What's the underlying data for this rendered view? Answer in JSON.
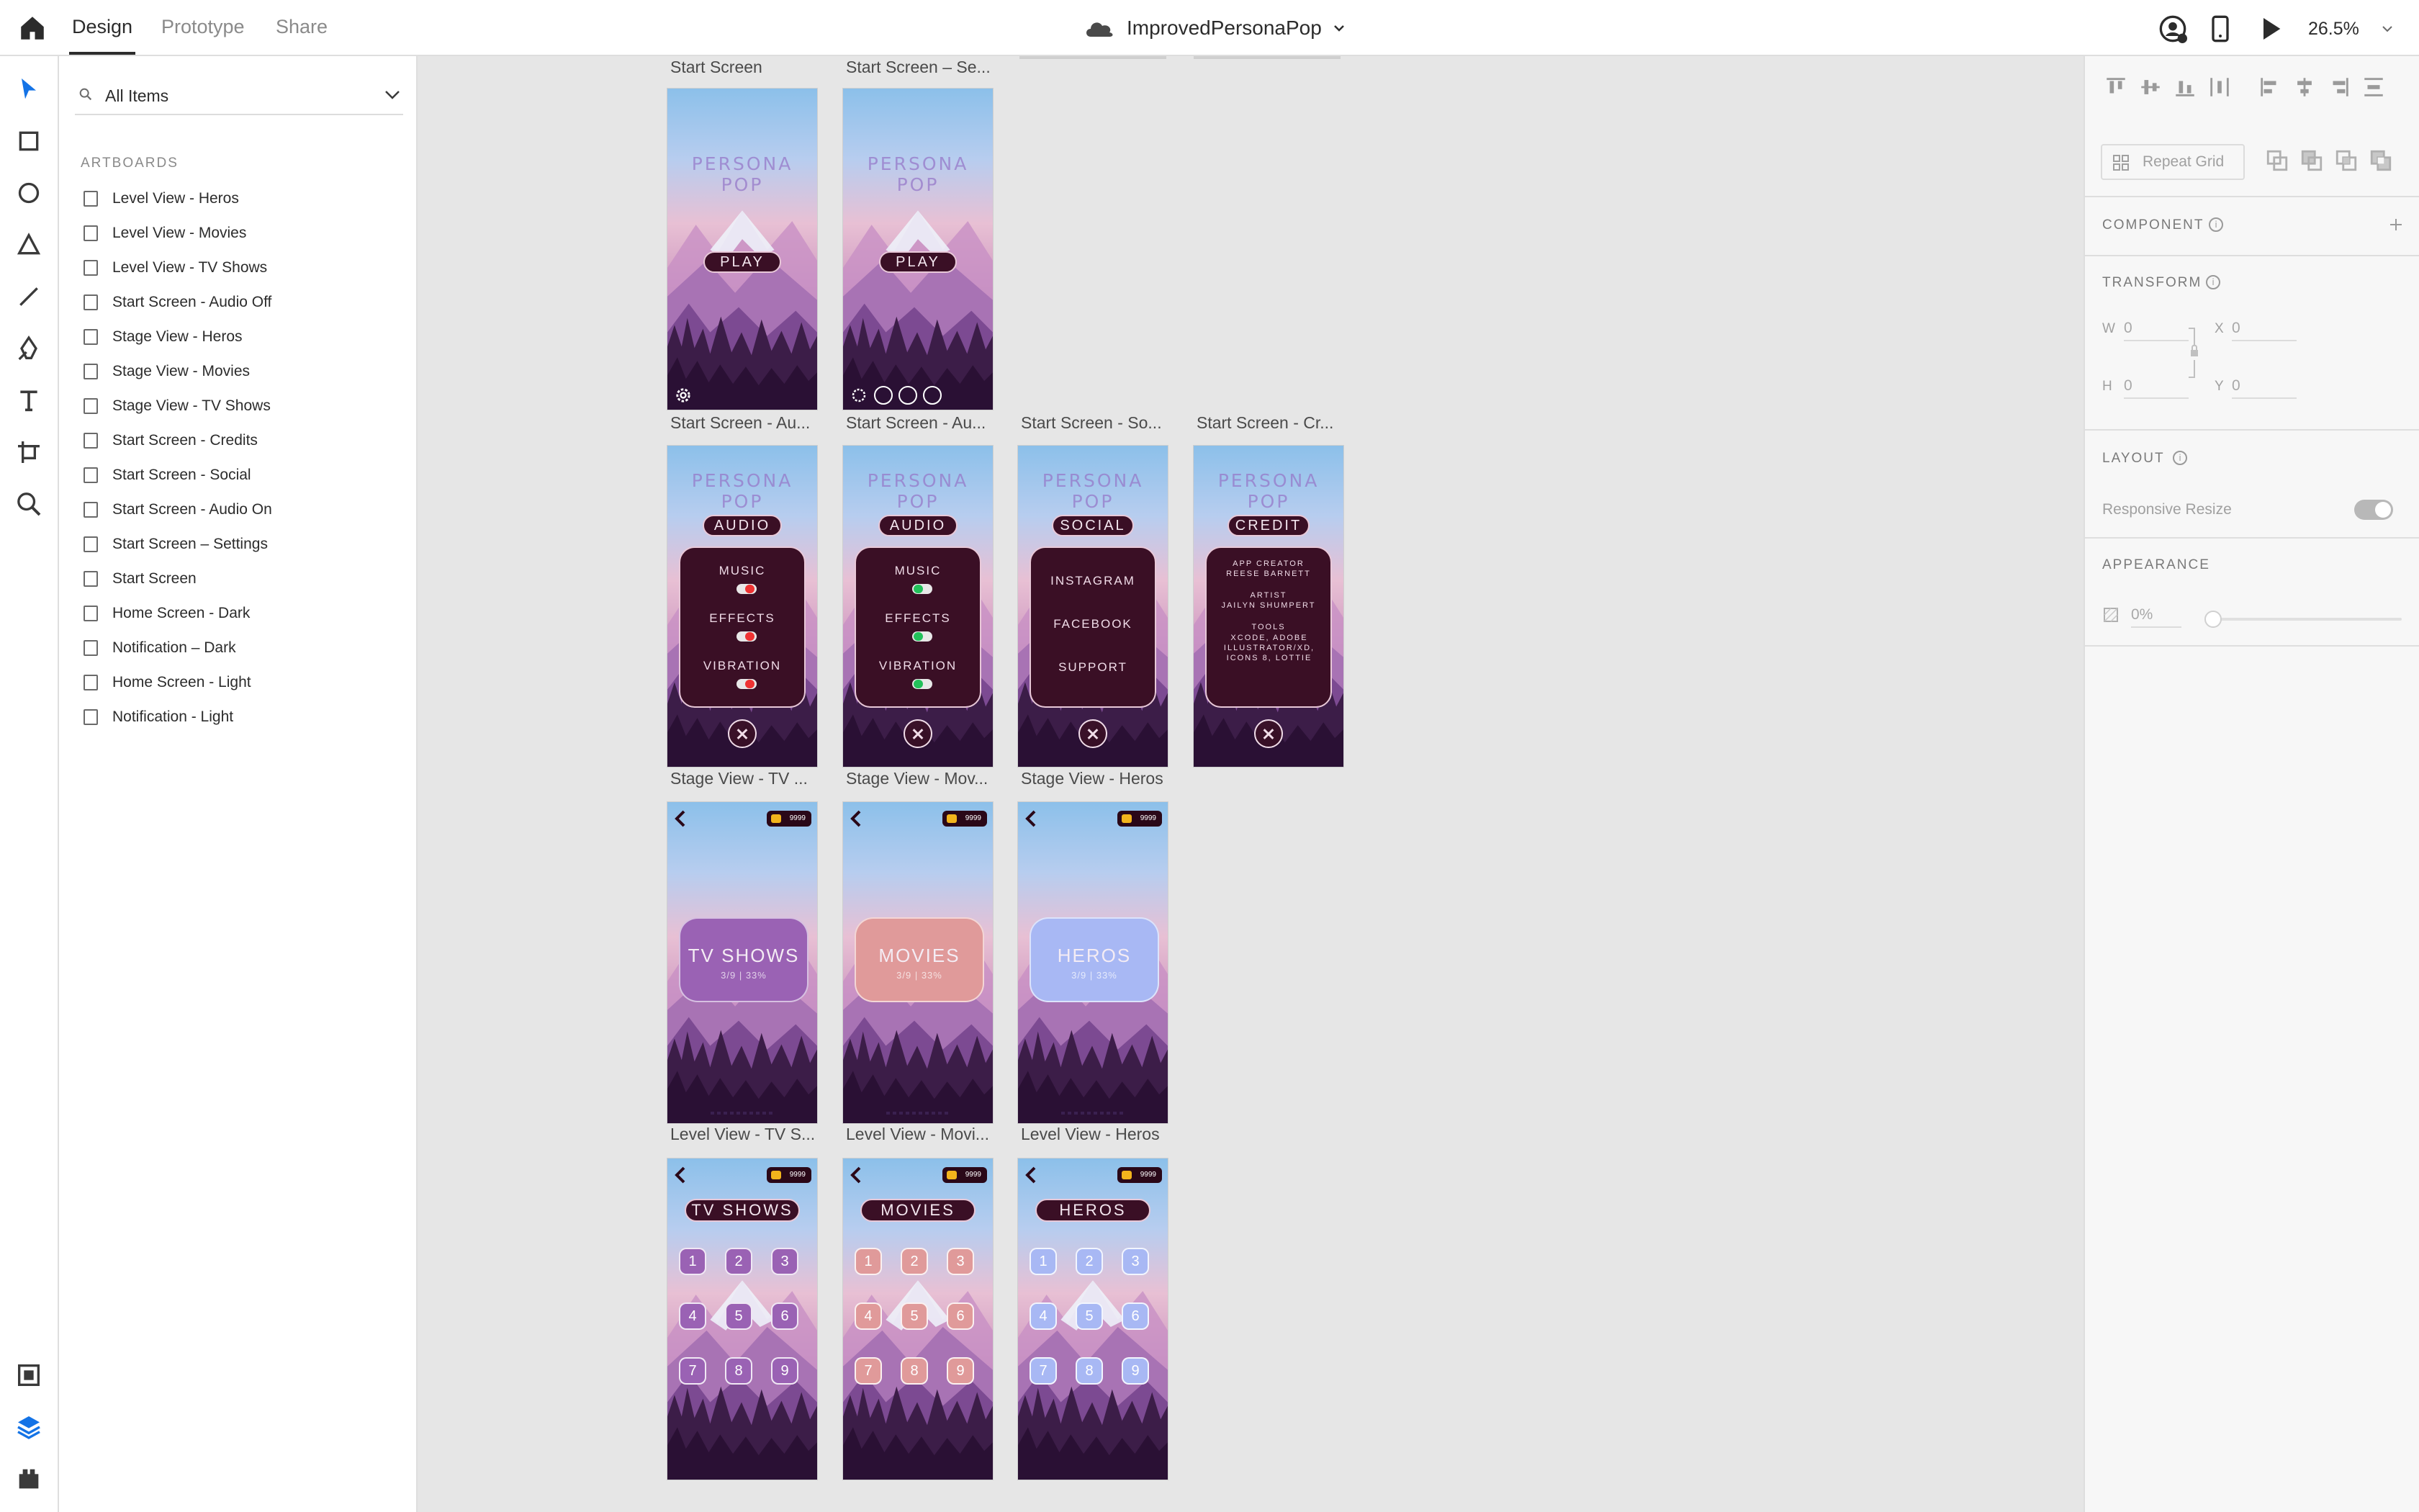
{
  "app": {
    "tabs": [
      {
        "label": "Design",
        "active": true
      },
      {
        "label": "Prototype"
      },
      {
        "label": "Share"
      }
    ],
    "document_title": "ImprovedPersonaPop",
    "zoom": "26.5%"
  },
  "layers": {
    "search_placeholder": "All Items",
    "section_label": "ARTBOARDS",
    "items": [
      "Level View - Heros",
      "Level View - Movies",
      "Level View - TV Shows",
      "Start Screen - Audio Off",
      "Stage View - Heros",
      "Stage View - Movies",
      "Stage View - TV Shows",
      "Start Screen - Credits",
      "Start Screen - Social",
      "Start Screen - Audio On",
      "Start Screen – Settings",
      "Start Screen",
      "Home Screen - Dark",
      "Notification – Dark",
      "Home Screen - Light",
      "Notification - Light"
    ]
  },
  "canvas": {
    "top_row_labels": [
      "Start Screen",
      "Start Screen – Se..."
    ],
    "logo": "PERSONA POP",
    "play_label": "PLAY",
    "row2_labels": [
      "Start Screen - Au...",
      "Start Screen - Au...",
      "Start Screen - So...",
      "Start Screen - Cr..."
    ],
    "audio": {
      "title": "AUDIO",
      "rows": [
        "MUSIC",
        "EFFECTS",
        "VIBRATION"
      ]
    },
    "social": {
      "title": "SOCIAL",
      "rows": [
        "INSTAGRAM",
        "FACEBOOK",
        "SUPPORT"
      ]
    },
    "credits": {
      "title": "CREDIT",
      "creator_h": "APP CREATOR",
      "creator": "REESE BARNETT",
      "artist_h": "ARTIST",
      "artist": "JAILYN SHUMPERT",
      "tools_h": "TOOLS",
      "tools": "XCODE, ADOBE ILLUSTRATOR/XD, ICONS 8, LOTTIE"
    },
    "row3_labels": [
      "Stage View - TV ...",
      "Stage View - Mov...",
      "Stage View - Heros"
    ],
    "coins": "9999",
    "stage_cards": [
      {
        "title": "TV SHOWS",
        "progress": "3/9 | 33%",
        "color": "#9a62b4"
      },
      {
        "title": "MOVIES",
        "progress": "3/9 | 33%",
        "color": "#e09a9a"
      },
      {
        "title": "HEROS",
        "progress": "3/9 | 33%",
        "color": "#a8b8f4"
      }
    ],
    "row4_labels": [
      "Level View - TV S...",
      "Level View - Movi...",
      "Level View - Heros"
    ],
    "levels": [
      "1",
      "2",
      "3",
      "4",
      "5",
      "6",
      "7",
      "8",
      "9"
    ]
  },
  "props": {
    "repeat_grid": "Repeat Grid",
    "component": "COMPONENT",
    "transform": "TRANSFORM",
    "w_label": "W",
    "w_value": "0",
    "x_label": "X",
    "x_value": "0",
    "h_label": "H",
    "h_value": "0",
    "y_label": "Y",
    "y_value": "0",
    "layout": "LAYOUT",
    "responsive_resize": "Responsive Resize",
    "appearance": "APPEARANCE",
    "opacity": "0%"
  },
  "colors": {
    "accent": "#1473e6",
    "panel_dark": "#3a0f25",
    "tv": "#9a62b4",
    "movies": "#e09a9a",
    "heros": "#a8b8f4"
  }
}
